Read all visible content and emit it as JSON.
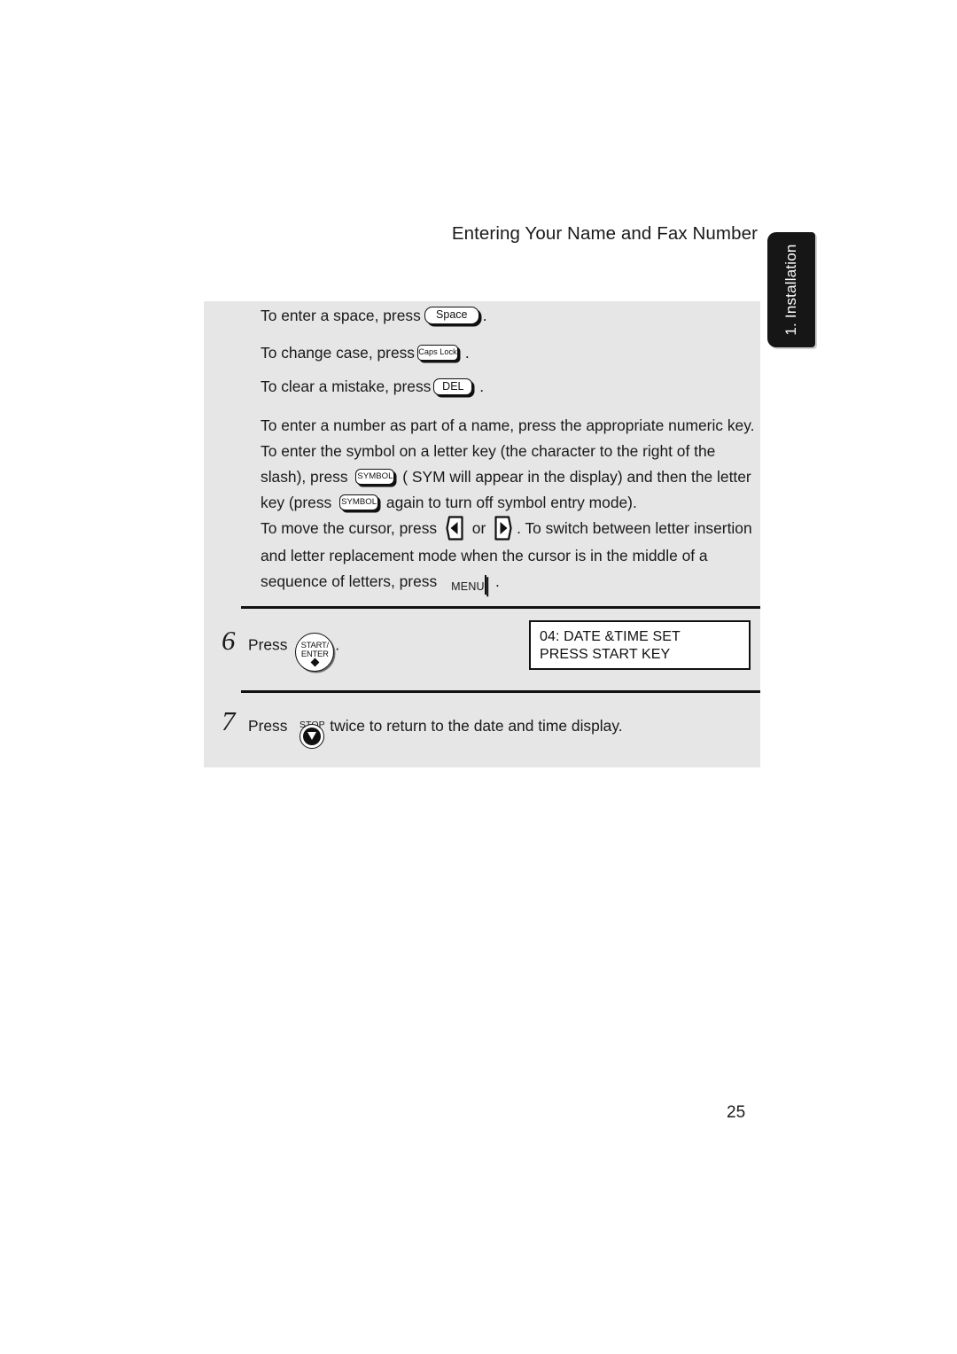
{
  "header": {
    "title": "Entering Your Name and Fax Number"
  },
  "side_tab": {
    "label": "1. Installation"
  },
  "panel": {
    "lines": {
      "space_before": "To enter a space, press",
      "space_after": ".",
      "case_before": "To change case, press",
      "case_after": ".",
      "del_before": "To clear a mistake, press",
      "del_after": ".",
      "symbol_part1": "To enter a number as part of a name, press the appropriate numeric key. To enter the symbol on a letter key (the character to the right of the slash), press",
      "symbol_part2": "( SYM  will appear in the display) and then the letter key (press",
      "symbol_part3": "again to turn off symbol entry mode).",
      "cursor_part1": "To move the cursor, press",
      "cursor_or": "or",
      "cursor_part2": ". To switch between letter insertion and letter replacement mode when the cursor is in the middle of a sequence of letters, press",
      "cursor_part3": "."
    }
  },
  "keys": {
    "space": "Space",
    "caps_lock": "Caps Lock",
    "del": "DEL",
    "symbol": "SYMBOL",
    "menu": "MENU",
    "start_line1": "START/",
    "start_line2": "ENTER",
    "stop": "STOP",
    "arrow_left_name": "left-arrow-key",
    "arrow_right_name": "right-arrow-key"
  },
  "steps": [
    {
      "number": "6",
      "text_before": "Press",
      "text_after": "."
    },
    {
      "number": "7",
      "text_before": "Press",
      "text_after": "twice to return to the date and time display."
    }
  ],
  "lcd": {
    "line1": "04: DATE &TIME SET",
    "line2": "PRESS START KEY"
  },
  "footer": {
    "page_number": "25"
  },
  "colors": {
    "panel_bg": "#e6e6e6",
    "tab_bg": "#161616",
    "ink": "#1a1a1a"
  }
}
